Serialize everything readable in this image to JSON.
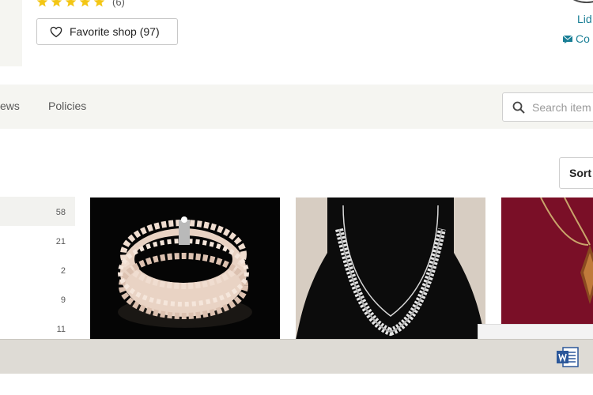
{
  "shop": {
    "rating_count": "(6)",
    "stars": 5,
    "favorite_label": "Favorite shop (97)",
    "owner_name": "Lid",
    "contact_label": "Co"
  },
  "nav": {
    "tabs": [
      "ews",
      "Policies"
    ],
    "search_placeholder": "Search item"
  },
  "sort_label": "Sort",
  "sections": [
    {
      "count": "58",
      "active": true
    },
    {
      "count": "21",
      "active": false
    },
    {
      "count": "2",
      "active": false
    },
    {
      "count": "9",
      "active": false
    },
    {
      "count": "11",
      "active": false
    }
  ],
  "colors": {
    "star": "#f3c614",
    "link": "#1a7f96",
    "nav_band": "#f5f5f1",
    "taskbar": "#dedbd5",
    "word_blue": "#2b579a"
  },
  "icons": [
    "star-icon",
    "heart-icon",
    "envelope-icon",
    "search-icon",
    "word-icon"
  ]
}
